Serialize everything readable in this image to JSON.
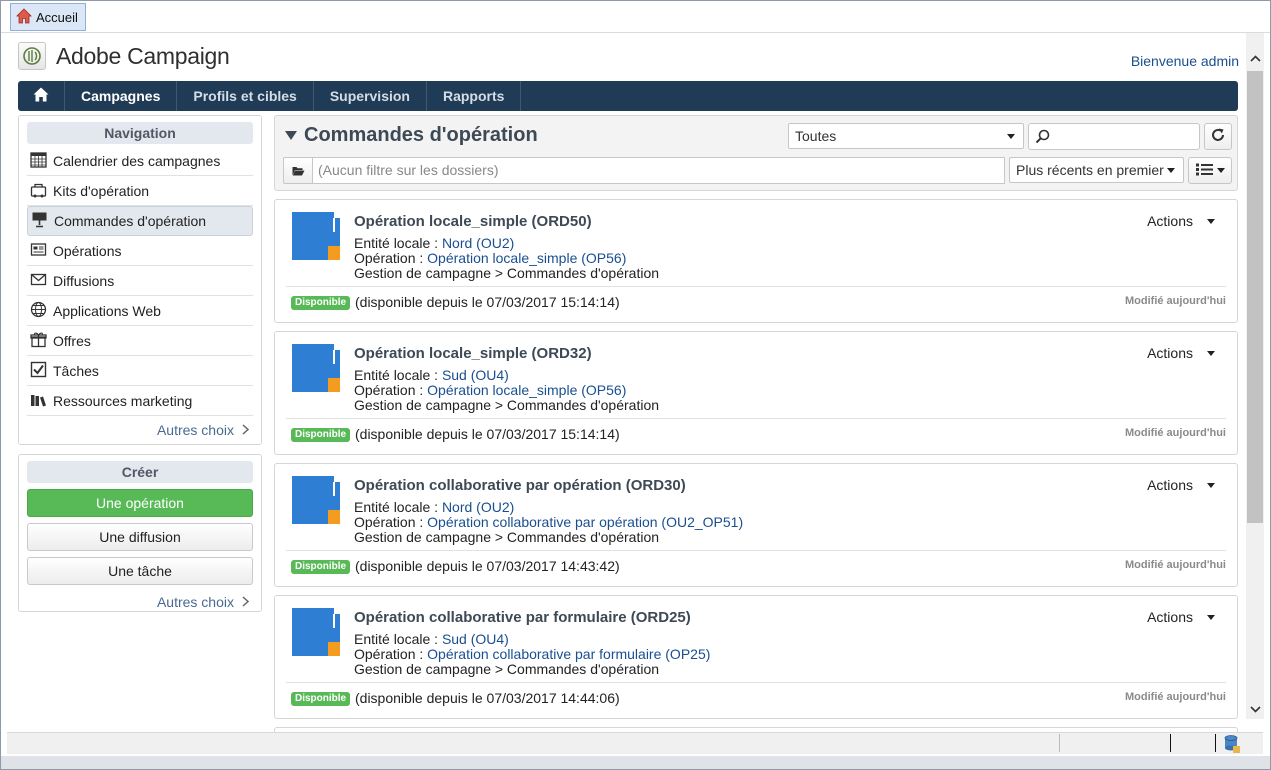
{
  "window": {
    "home_tab_label": "Accueil"
  },
  "header": {
    "app_title": "Adobe Campaign",
    "welcome": "Bienvenue admin"
  },
  "topnav": {
    "items": [
      "Campagnes",
      "Profils et cibles",
      "Supervision",
      "Rapports"
    ],
    "active": "Campagnes"
  },
  "navigation": {
    "title": "Navigation",
    "items": [
      {
        "label": "Calendrier des campagnes",
        "icon": "calendar-icon"
      },
      {
        "label": "Kits d'opération",
        "icon": "kit-icon"
      },
      {
        "label": "Commandes d'opération",
        "icon": "order-icon"
      },
      {
        "label": "Opérations",
        "icon": "operations-icon"
      },
      {
        "label": "Diffusions",
        "icon": "envelope-icon"
      },
      {
        "label": "Applications Web",
        "icon": "globe-icon"
      },
      {
        "label": "Offres",
        "icon": "gift-icon"
      },
      {
        "label": "Tâches",
        "icon": "checkbox-icon"
      },
      {
        "label": "Ressources marketing",
        "icon": "books-icon"
      }
    ],
    "active": "Commandes d'opération",
    "more": "Autres choix"
  },
  "create": {
    "title": "Créer",
    "buttons": [
      "Une opération",
      "Une diffusion",
      "Une tâche"
    ],
    "more": "Autres choix"
  },
  "toolbar": {
    "title": "Commandes d'opération",
    "filter_select": "Toutes",
    "search_value": "",
    "folder_filter_placeholder": "(Aucun filtre sur les dossiers)",
    "sort_select": "Plus récents en premier"
  },
  "orders": [
    {
      "title": "Opération locale_simple (ORD50)",
      "entity_label": "Entité locale : ",
      "entity": "Nord (OU2)",
      "operation_label": "Opération : ",
      "operation": "Opération locale_simple (OP56)",
      "path": "Gestion de campagne > Commandes d'opération",
      "actions": "Actions",
      "badge": "Disponible",
      "status": "(disponible depuis le 07/03/2017 15:14:14)",
      "modified": "Modifié aujourd'hui"
    },
    {
      "title": "Opération locale_simple (ORD32)",
      "entity_label": "Entité locale : ",
      "entity": "Sud (OU4)",
      "operation_label": "Opération : ",
      "operation": "Opération locale_simple (OP56)",
      "path": "Gestion de campagne > Commandes d'opération",
      "actions": "Actions",
      "badge": "Disponible",
      "status": "(disponible depuis le 07/03/2017 15:14:14)",
      "modified": "Modifié aujourd'hui"
    },
    {
      "title": "Opération collaborative par opération (ORD30)",
      "entity_label": "Entité locale : ",
      "entity": "Nord (OU2)",
      "operation_label": "Opération : ",
      "operation": "Opération collaborative par opération (OU2_OP51)",
      "path": "Gestion de campagne > Commandes d'opération",
      "actions": "Actions",
      "badge": "Disponible",
      "status": "(disponible depuis le 07/03/2017 14:43:42)",
      "modified": "Modifié aujourd'hui"
    },
    {
      "title": "Opération collaborative par formulaire (ORD25)",
      "entity_label": "Entité locale : ",
      "entity": "Sud (OU4)",
      "operation_label": "Opération : ",
      "operation": "Opération collaborative par formulaire (OP25)",
      "path": "Gestion de campagne > Commandes d'opération",
      "actions": "Actions",
      "badge": "Disponible",
      "status": "(disponible depuis le 07/03/2017 14:44:06)",
      "modified": "Modifié aujourd'hui"
    }
  ],
  "colors": {
    "nav_bar": "#1f3b55",
    "accent_green": "#58b957",
    "link_blue": "#1a4f8f",
    "order_icon_blue": "#2e7fd4",
    "order_icon_orange": "#f39c1f"
  }
}
